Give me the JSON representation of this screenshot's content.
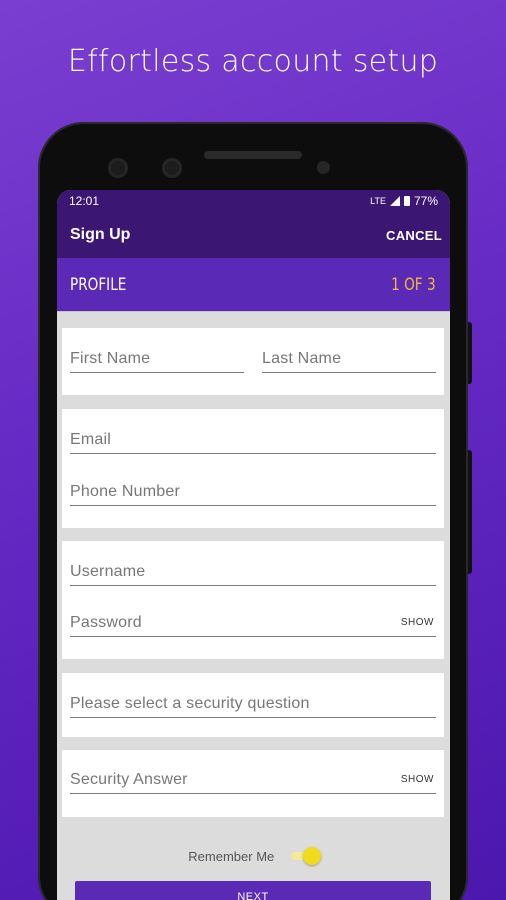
{
  "headline": "Effortless account setup",
  "status_bar": {
    "time": "12:01",
    "network": "LTE",
    "battery": "77%"
  },
  "app_bar": {
    "title": "Sign Up",
    "cancel_label": "CANCEL"
  },
  "step": {
    "title": "PROFILE",
    "count": "1 OF 3"
  },
  "form": {
    "first_name": "First Name",
    "last_name": "Last Name",
    "email": "Email",
    "phone": "Phone Number",
    "username": "Username",
    "password": "Password",
    "password_show": "SHOW",
    "security_question": "Please select a security question",
    "security_answer": "Security Answer",
    "answer_show": "SHOW"
  },
  "remember_me": {
    "label": "Remember Me",
    "enabled": true
  },
  "next_label": "NEXT",
  "colors": {
    "header": "#3c1673",
    "accent": "#5a2ab6",
    "step_count": "#f5b83a",
    "toggle": "#f0dc1a"
  }
}
